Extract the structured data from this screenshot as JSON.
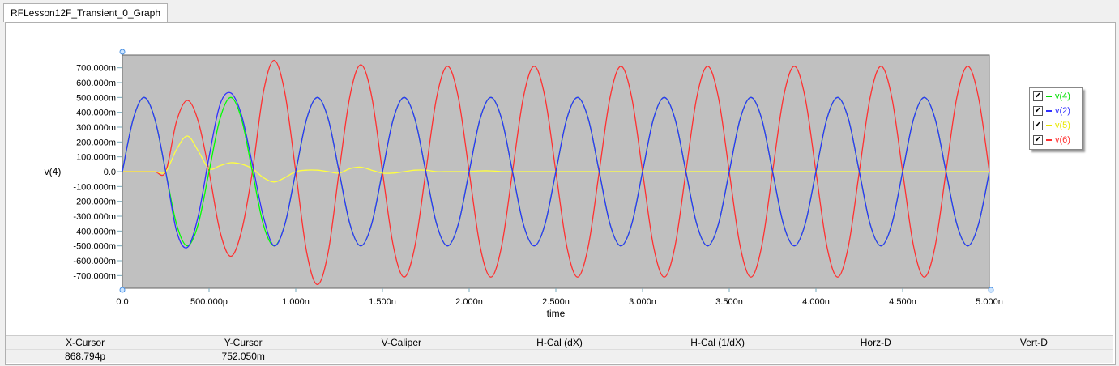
{
  "tab": {
    "label": "RFLesson12F_Transient_0_Graph"
  },
  "chart_data": {
    "type": "line",
    "xlabel": "time",
    "ylabel": "v(4)",
    "xlim": [
      0,
      5e-09
    ],
    "ylim": [
      -0.75,
      0.75
    ],
    "x_ticks": [
      {
        "v": 0,
        "l": "0.0"
      },
      {
        "v": 5e-10,
        "l": "500.000p"
      },
      {
        "v": 1e-09,
        "l": "1.000n"
      },
      {
        "v": 1.5e-09,
        "l": "1.500n"
      },
      {
        "v": 2e-09,
        "l": "2.000n"
      },
      {
        "v": 2.5e-09,
        "l": "2.500n"
      },
      {
        "v": 3e-09,
        "l": "3.000n"
      },
      {
        "v": 3.5e-09,
        "l": "3.500n"
      },
      {
        "v": 4e-09,
        "l": "4.000n"
      },
      {
        "v": 4.5e-09,
        "l": "4.500n"
      },
      {
        "v": 5e-09,
        "l": "5.000n"
      }
    ],
    "y_ticks": [
      {
        "v": 0.7,
        "l": "700.000m"
      },
      {
        "v": 0.6,
        "l": "600.000m"
      },
      {
        "v": 0.5,
        "l": "500.000m"
      },
      {
        "v": 0.4,
        "l": "400.000m"
      },
      {
        "v": 0.3,
        "l": "300.000m"
      },
      {
        "v": 0.2,
        "l": "200.000m"
      },
      {
        "v": 0.1,
        "l": "100.000m"
      },
      {
        "v": 0,
        "l": "0.0"
      },
      {
        "v": -0.1,
        "l": "-100.000m"
      },
      {
        "v": -0.2,
        "l": "-200.000m"
      },
      {
        "v": -0.3,
        "l": "-300.000m"
      },
      {
        "v": -0.4,
        "l": "-400.000m"
      },
      {
        "v": -0.5,
        "l": "-500.000m"
      },
      {
        "v": -0.6,
        "l": "-600.000m"
      },
      {
        "v": -0.7,
        "l": "-700.000m"
      }
    ],
    "x_step": 6.25e-11,
    "background": "#c0c0c0",
    "legend_position": "right",
    "series": [
      {
        "name": "v(6)",
        "color": "#ff3030",
        "values": [
          0,
          0,
          0,
          0,
          0,
          0.34,
          0.48,
          0.34,
          0,
          -0.4,
          -0.57,
          -0.4,
          0,
          0.53,
          0.75,
          0.53,
          0,
          -0.54,
          -0.76,
          -0.54,
          0,
          0.51,
          0.72,
          0.51,
          0,
          -0.5,
          -0.71,
          -0.5,
          0,
          0.5,
          0.71,
          0.5,
          0,
          -0.5,
          -0.71,
          -0.5,
          0,
          0.5,
          0.71,
          0.5,
          0,
          -0.5,
          -0.71,
          -0.5,
          0,
          0.5,
          0.71,
          0.5,
          0,
          -0.5,
          -0.71,
          -0.5,
          0,
          0.5,
          0.71,
          0.5,
          0,
          -0.5,
          -0.71,
          -0.5,
          0,
          0.5,
          0.71,
          0.5,
          0,
          -0.5,
          -0.71,
          -0.5,
          0,
          0.5,
          0.71,
          0.5,
          0,
          -0.5,
          -0.71,
          -0.5,
          0,
          0.5,
          0.71,
          0.5,
          0
        ]
      },
      {
        "name": "v(5)",
        "color": "#ffff40",
        "values": [
          0,
          0,
          0,
          0,
          0,
          0.15,
          0.24,
          0.14,
          0.02,
          0.04,
          0.06,
          0.05,
          0.02,
          -0.04,
          -0.07,
          -0.04,
          0,
          0.01,
          0.01,
          0,
          -0.01,
          0.02,
          0.03,
          0.01,
          -0.01,
          -0.01,
          0,
          0.01,
          0.01,
          0,
          0,
          0,
          0,
          0.005,
          0.005,
          0,
          0,
          0,
          0,
          0,
          0,
          0,
          0,
          0,
          0,
          0,
          0,
          0,
          0,
          0,
          0,
          0,
          0,
          0,
          0,
          0,
          0,
          0,
          0,
          0,
          0,
          0,
          0,
          0,
          0,
          0,
          0,
          0,
          0,
          0,
          0,
          0,
          0,
          0,
          0,
          0,
          0,
          0,
          0,
          0,
          0
        ]
      },
      {
        "name": "v(4)",
        "color": "#00ff00",
        "values": [
          0,
          0.354,
          0.5,
          0.354,
          0,
          -0.354,
          -0.5,
          -0.354,
          0,
          0.354,
          0.5,
          0.354,
          0,
          -0.354,
          -0.5,
          -0.354,
          0,
          0.354,
          0.5,
          0.354,
          0,
          -0.354,
          -0.5,
          -0.354,
          0,
          0.354,
          0.5,
          0.354,
          0,
          -0.354,
          -0.5,
          -0.354,
          0,
          0.354,
          0.5,
          0.354,
          0,
          -0.354,
          -0.5,
          -0.354,
          0,
          0.354,
          0.5,
          0.354,
          0,
          -0.354,
          -0.5,
          -0.354,
          0,
          0.354,
          0.5,
          0.354,
          0,
          -0.354,
          -0.5,
          -0.354,
          0,
          0.354,
          0.5,
          0.354,
          0,
          -0.354,
          -0.5,
          -0.354,
          0,
          0.354,
          0.5,
          0.354,
          0,
          -0.354,
          -0.5,
          -0.354,
          0,
          0.354,
          0.5,
          0.354,
          0,
          -0.354,
          -0.5,
          -0.354,
          0
        ]
      },
      {
        "name": "v(2)",
        "color": "#3030ff",
        "values": [
          0,
          0.354,
          0.5,
          0.354,
          0,
          -0.4,
          -0.51,
          -0.3,
          0.1,
          0.45,
          0.53,
          0.38,
          0.05,
          -0.3,
          -0.5,
          -0.354,
          0,
          0.354,
          0.5,
          0.354,
          0,
          -0.354,
          -0.5,
          -0.354,
          0,
          0.354,
          0.5,
          0.354,
          0,
          -0.354,
          -0.5,
          -0.354,
          0,
          0.354,
          0.5,
          0.354,
          0,
          -0.354,
          -0.5,
          -0.354,
          0,
          0.354,
          0.5,
          0.354,
          0,
          -0.354,
          -0.5,
          -0.354,
          0,
          0.354,
          0.5,
          0.354,
          0,
          -0.354,
          -0.5,
          -0.354,
          0,
          0.354,
          0.5,
          0.354,
          0,
          -0.354,
          -0.5,
          -0.354,
          0,
          0.354,
          0.5,
          0.354,
          0,
          -0.354,
          -0.5,
          -0.354,
          0,
          0.354,
          0.5,
          0.354,
          0,
          -0.354,
          -0.5,
          -0.354,
          0
        ]
      }
    ]
  },
  "legend": [
    {
      "name": "v(4)",
      "color": "#00e000",
      "checked": "✔"
    },
    {
      "name": "v(2)",
      "color": "#3030ff",
      "checked": "✔"
    },
    {
      "name": "v(5)",
      "color": "#e8e800",
      "checked": "✔"
    },
    {
      "name": "v(6)",
      "color": "#ff3030",
      "checked": "✔"
    }
  ],
  "cursor_table": {
    "headers": [
      "X-Cursor",
      "Y-Cursor",
      "V-Caliper",
      "H-Cal (dX)",
      "H-Cal (1/dX)",
      "Horz-D",
      "Vert-D"
    ],
    "values": [
      "868.794p",
      "752.050m",
      "",
      "",
      "",
      "",
      ""
    ]
  }
}
